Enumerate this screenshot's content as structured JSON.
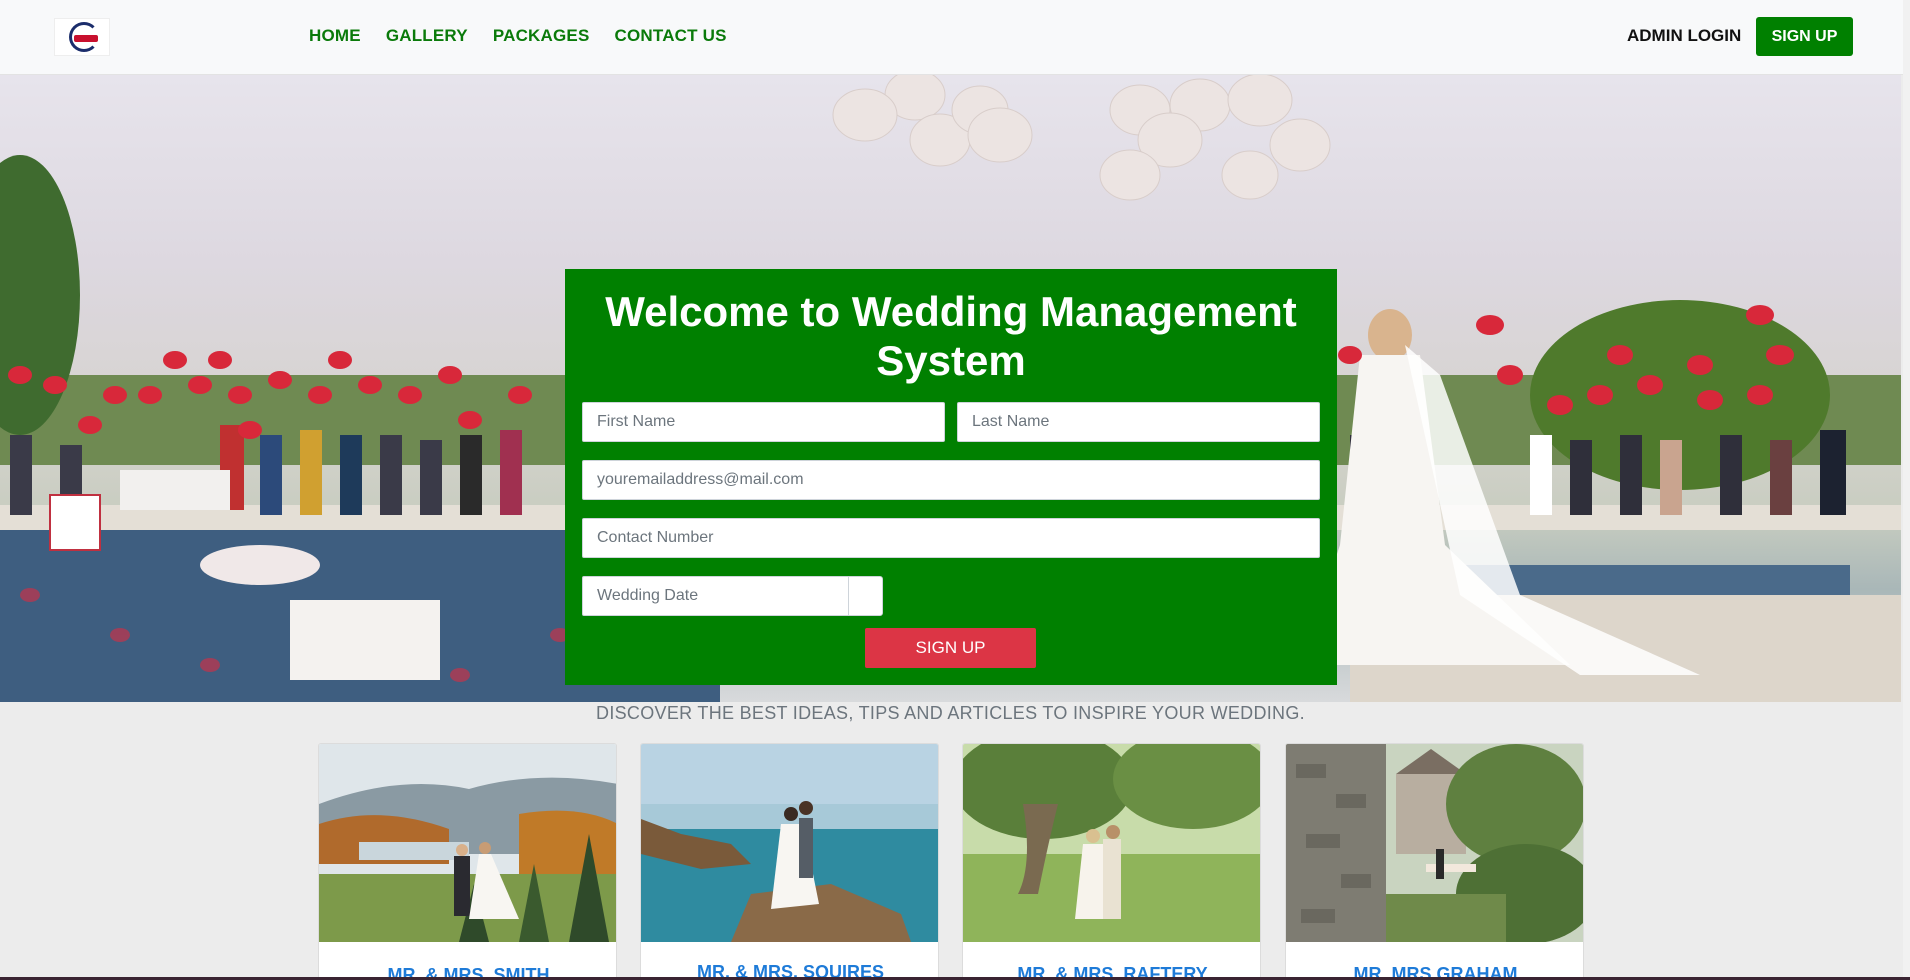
{
  "nav": {
    "links": [
      "HOME",
      "GALLERY",
      "PACKAGES",
      "CONTACT US"
    ],
    "admin_login": "ADMIN LOGIN",
    "signup": "SIGN UP"
  },
  "hero": {
    "title": "Welcome to Wedding Management System",
    "form": {
      "first_name_placeholder": "First Name",
      "last_name_placeholder": "Last Name",
      "email_placeholder": "youremailaddress@mail.com",
      "contact_placeholder": "Contact Number",
      "wedding_date_placeholder": "Wedding Date",
      "submit_label": "SIGN UP"
    }
  },
  "tagline": "DISCOVER THE BEST IDEAS, TIPS AND ARTICLES TO INSPIRE YOUR WEDDING.",
  "cards": [
    {
      "title": "MR. & MRS. SMITH"
    },
    {
      "title": "MR. & MRS. SQUIRES"
    },
    {
      "title": "MR. & MRS. RAFTERY"
    },
    {
      "title": "MR. MRS GRAHAM"
    }
  ],
  "colors": {
    "brand_green": "#008000",
    "nav_link_green": "#0a7a0a",
    "signup_red": "#dc3545",
    "card_title_blue": "#1e7bd8"
  }
}
